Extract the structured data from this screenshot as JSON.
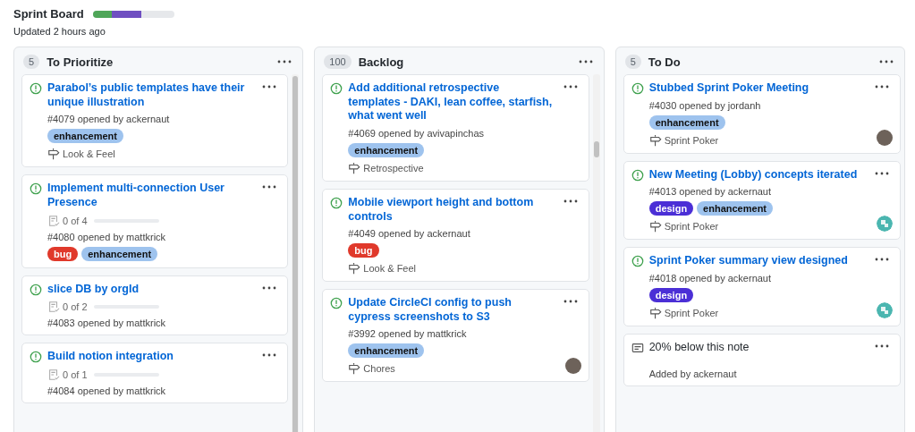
{
  "board": {
    "title": "Sprint Board",
    "progress": [
      {
        "color": "#4fa659",
        "level": 0.23
      },
      {
        "color": "#6f4fc1",
        "level": 0.37
      }
    ],
    "updated": "Updated 2 hours ago"
  },
  "columns": [
    {
      "count": "5",
      "name": "To Prioritize",
      "scrollbar": {
        "kind": "long"
      },
      "cards": [
        {
          "kind": "issue",
          "title": "Parabol’s public templates have their unique illustration",
          "meta": "#4079 opened by ackernaut",
          "labels": [
            {
              "text": "enhancement",
              "color": "#9ec3ee"
            }
          ],
          "milestone": "Look & Feel"
        },
        {
          "kind": "issue",
          "title": "Implement multi-connection User Presence",
          "tasks": {
            "text": "0 of 4",
            "level": 0
          },
          "meta": "#4080 opened by mattkrick",
          "labels": [
            {
              "text": "bug",
              "color": "#e0392b"
            },
            {
              "text": "enhancement",
              "color": "#9ec3ee"
            }
          ]
        },
        {
          "kind": "issue",
          "title": "slice DB by orgId",
          "tasks": {
            "text": "0 of 2",
            "level": 0
          },
          "meta": "#4083 opened by mattkrick"
        },
        {
          "kind": "issue",
          "title": "Build notion integration",
          "tasks": {
            "text": "0 of 1",
            "level": 0
          },
          "meta": "#4084 opened by mattkrick"
        }
      ]
    },
    {
      "count": "100",
      "name": "Backlog",
      "scrollbar": {
        "kind": "short"
      },
      "cards": [
        {
          "kind": "issue",
          "title": "Add additional retrospective templates - DAKI, lean coffee, starfish, what went well",
          "meta": "#4069 opened by avivapinchas",
          "labels": [
            {
              "text": "enhancement",
              "color": "#9ec3ee"
            }
          ],
          "milestone": "Retrospective"
        },
        {
          "kind": "issue",
          "title": "Mobile viewport height and bottom controls",
          "meta": "#4049 opened by ackernaut",
          "labels": [
            {
              "text": "bug",
              "color": "#e0392b"
            }
          ],
          "milestone": "Look & Feel"
        },
        {
          "kind": "issue",
          "title": "Update CircleCI config to push cypress screenshots to S3",
          "meta": "#3992 opened by mattkrick",
          "labels": [
            {
              "text": "enhancement",
              "color": "#9ec3ee"
            }
          ],
          "milestone": "Chores",
          "avatar": {
            "kind": "photo"
          }
        }
      ]
    },
    {
      "count": "5",
      "name": "To Do",
      "cards": [
        {
          "kind": "issue",
          "title": "Stubbed Sprint Poker Meeting",
          "meta": "#4030 opened by jordanh",
          "labels": [
            {
              "text": "enhancement",
              "color": "#9ec3ee"
            }
          ],
          "milestone": "Sprint Poker",
          "avatar": {
            "kind": "photo"
          }
        },
        {
          "kind": "issue",
          "title": "New Meeting (Lobby) concepts iterated",
          "meta": "#4013 opened by ackernaut",
          "labels": [
            {
              "text": "design",
              "color": "#4b2fd6"
            },
            {
              "text": "enhancement",
              "color": "#9ec3ee"
            }
          ],
          "milestone": "Sprint Poker",
          "avatar": {
            "kind": "identicon"
          }
        },
        {
          "kind": "issue",
          "title": "Sprint Poker summary view designed",
          "meta": "#4018 opened by ackernaut",
          "labels": [
            {
              "text": "design",
              "color": "#4b2fd6"
            }
          ],
          "milestone": "Sprint Poker",
          "avatar": {
            "kind": "identicon"
          }
        },
        {
          "kind": "note",
          "title": "20% below this note",
          "meta": "Added by ackernaut"
        }
      ]
    }
  ]
}
